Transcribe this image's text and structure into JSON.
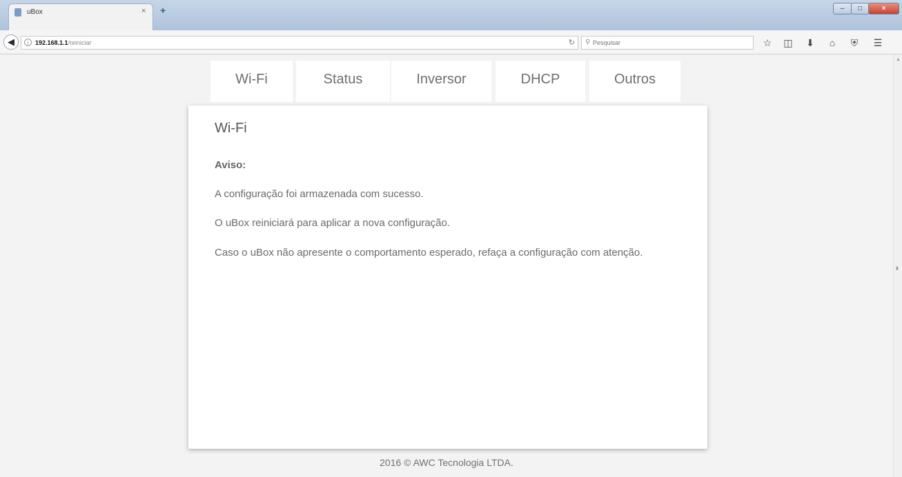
{
  "browser": {
    "tab_title": "uBox",
    "tab_close": "×",
    "new_tab": "+",
    "url_host": "192.168.1.1",
    "url_path": "/reiniciar",
    "search_placeholder": "Pesquisar",
    "window_controls": {
      "minimize": "–",
      "maximize": "□",
      "close": "×"
    }
  },
  "nav": {
    "tabs": [
      {
        "label": "Wi-Fi"
      },
      {
        "label": "Status"
      },
      {
        "label": "Inversor"
      },
      {
        "label": "DHCP"
      },
      {
        "label": "Outros"
      }
    ]
  },
  "content": {
    "title": "Wi-Fi",
    "warning_label": "Aviso:",
    "messages": [
      "A configuração foi armazenada com sucesso.",
      "O uBox reiniciará para aplicar a nova configuração.",
      "Caso o uBox não apresente o comportamento esperado, refaça a configuração com atenção."
    ]
  },
  "footer": {
    "text": "2016 © AWC Tecnologia LTDA."
  }
}
